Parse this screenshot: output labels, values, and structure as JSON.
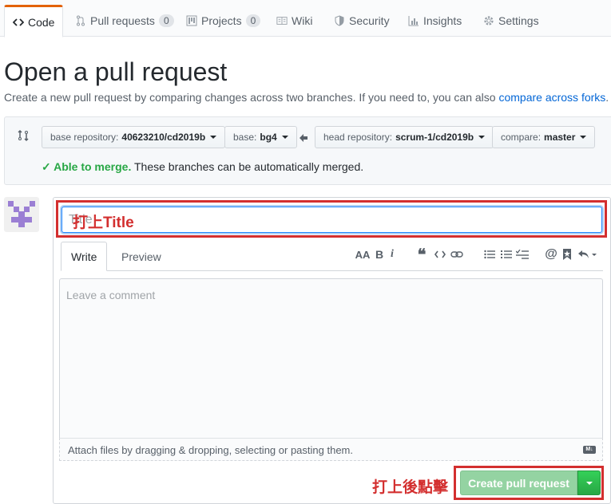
{
  "tabs": [
    {
      "label": "Code",
      "icon": "code-icon"
    },
    {
      "label": "Pull requests",
      "icon": "pull-request-icon",
      "count": "0"
    },
    {
      "label": "Projects",
      "icon": "project-icon",
      "count": "0"
    },
    {
      "label": "Wiki",
      "icon": "book-icon"
    },
    {
      "label": "Security",
      "icon": "shield-icon"
    },
    {
      "label": "Insights",
      "icon": "graph-icon"
    },
    {
      "label": "Settings",
      "icon": "gear-icon"
    }
  ],
  "header": {
    "title": "Open a pull request",
    "subtitle": "Create a new pull request by comparing changes across two branches. If you need to, you can also ",
    "subtitle_link": "compare across forks",
    "subtitle_end": "."
  },
  "compare": {
    "base_repo_prefix": "base repository:",
    "base_repo": "40623210/cd2019b",
    "base_prefix": "base:",
    "base": "bg4",
    "head_repo_prefix": "head repository:",
    "head_repo": "scrum-1/cd2019b",
    "compare_prefix": "compare:",
    "compare": "master",
    "merge_ok": "✓ Able to merge.",
    "merge_msg": " These branches can be automatically merged."
  },
  "form": {
    "title_placeholder": "Title",
    "write_tab": "Write",
    "preview_tab": "Preview",
    "comment_placeholder": "Leave a comment",
    "attach_text": "Attach files by dragging & dropping, selecting or pasting them.",
    "markdown_icon": "markdown-icon",
    "submit_label": "Create pull request"
  },
  "annotations": {
    "title_note": "打上Title",
    "submit_note": "打上後點擊",
    "color": "#d32f2f"
  },
  "colors": {
    "accent": "#e36209",
    "link": "#0366d6",
    "success": "#28a745",
    "button_disabled": "#94d3a2"
  }
}
